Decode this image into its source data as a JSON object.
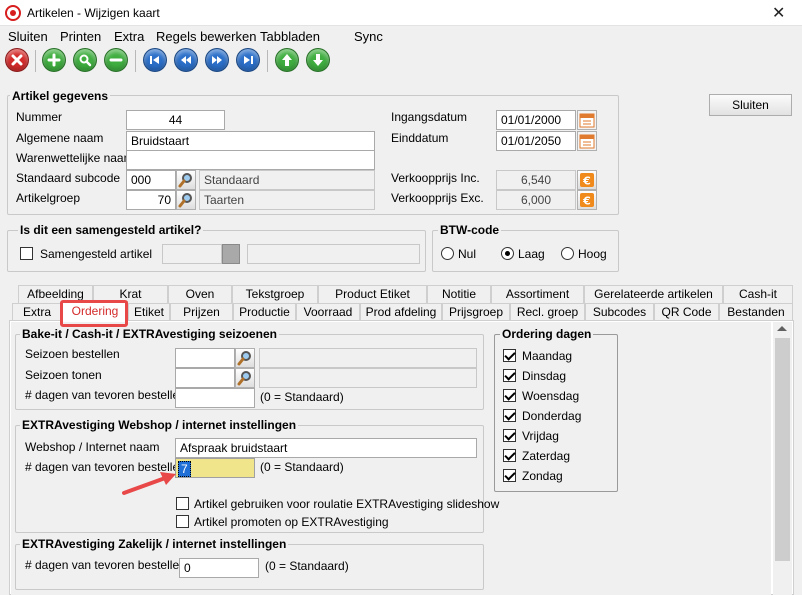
{
  "window": {
    "title": "Artikelen - Wijzigen kaart"
  },
  "menu": {
    "sluiten": "Sluiten",
    "printen": "Printen",
    "extra": "Extra",
    "regels": "Regels bewerken",
    "tabbladen": "Tabbladen",
    "sync": "Sync"
  },
  "toolbar_icons": [
    "close-circle-icon",
    "plus-circle-icon",
    "magnifier-circle-icon",
    "minus-circle-icon",
    "first-record-icon",
    "previous-record-icon",
    "next-record-icon",
    "last-record-icon",
    "arrow-up-icon",
    "arrow-down-icon"
  ],
  "colors": {
    "red_button": "#d42a2a",
    "green_button": "#3fae3f",
    "blue_button": "#2b6fc9",
    "highlight_field": "#f0e58a",
    "annotation": "#e84848"
  },
  "artikel": {
    "title": "Artikel gegevens",
    "nummer_label": "Nummer",
    "nummer": "44",
    "algemene_naam_label": "Algemene naam",
    "algemene_naam": "Bruidstaart",
    "warenwet_label": "Warenwettelijke naam",
    "warenwet": "",
    "subcode_label": "Standaard subcode",
    "subcode": "000",
    "subcode_name": "Standaard",
    "groep_label": "Artikelgroep",
    "groep": "70",
    "groep_name": "Taarten",
    "ingang_label": "Ingangsdatum",
    "ingang": "01/01/2000",
    "eind_label": "Einddatum",
    "eind": "01/01/2050",
    "vk_inc_label": "Verkoopprijs Inc.",
    "vk_inc": "6,540",
    "vk_exc_label": "Verkoopprijs Exc.",
    "vk_exc": "6,000",
    "sluiten_button": "Sluiten"
  },
  "samengesteld": {
    "title": "Is dit een samengesteld artikel?",
    "checkbox_label": "Samengesteld artikel",
    "checked": false
  },
  "btw": {
    "title": "BTW-code",
    "options": [
      "Nul",
      "Laag",
      "Hoog"
    ],
    "selected": "Laag"
  },
  "tabs_row1": [
    "Afbeelding",
    "Krat",
    "Oven",
    "Tekstgroep",
    "Product Etiket",
    "Notitie",
    "Assortiment",
    "Gerelateerde artikelen",
    "Cash-it"
  ],
  "tabs_row2": [
    "Extra",
    "Ordering",
    "Etiket",
    "Prijzen",
    "Productie",
    "Voorraad",
    "Prod afdeling",
    "Prijsgroep",
    "Recl. groep",
    "Subcodes",
    "QR Code",
    "Bestanden"
  ],
  "active_tab": "Ordering",
  "bake": {
    "title": "Bake-it / Cash-it / EXTRAvestiging seizoenen",
    "seizoen_bestellen_label": "Seizoen bestellen",
    "seizoen_bestellen": "",
    "seizoen_tonen_label": "Seizoen tonen",
    "seizoen_tonen": "",
    "dagen_label": "# dagen van tevoren bestellen",
    "dagen": "",
    "dagen_note": "(0 = Standaard)"
  },
  "webshop": {
    "title": "EXTRAvestiging Webshop / internet instellingen",
    "naam_label": "Webshop / Internet naam",
    "naam": "Afspraak bruidstaart",
    "dagen_label": "# dagen van tevoren bestellen",
    "dagen": "7",
    "dagen_note": "(0 = Standaard)",
    "slideshow_label": "Artikel gebruiken voor roulatie EXTRAvestiging slideshow",
    "slideshow_checked": false,
    "promoten_label": "Artikel promoten op EXTRAvestiging",
    "promoten_checked": false
  },
  "zakelijk": {
    "title": "EXTRAvestiging Zakelijk / internet instellingen",
    "dagen_label": "# dagen van tevoren bestellen",
    "dagen": "0",
    "dagen_note": "(0 = Standaard)"
  },
  "ordering_dagen": {
    "title": "Ordering dagen",
    "days": [
      {
        "label": "Maandag",
        "checked": true
      },
      {
        "label": "Dinsdag",
        "checked": true
      },
      {
        "label": "Woensdag",
        "checked": true
      },
      {
        "label": "Donderdag",
        "checked": true
      },
      {
        "label": "Vrijdag",
        "checked": true
      },
      {
        "label": "Zaterdag",
        "checked": true
      },
      {
        "label": "Zondag",
        "checked": true
      }
    ]
  }
}
